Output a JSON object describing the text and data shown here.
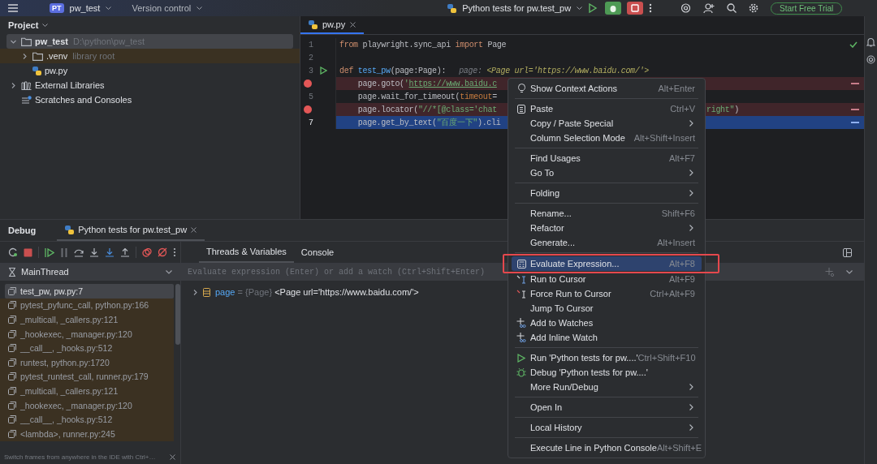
{
  "top_bar": {
    "project_badge": "PT",
    "project": "pw_test",
    "vcs": "Version control",
    "run_config": "Python tests for pw.test_pw",
    "trial_button": "Start Free Trial"
  },
  "project_panel": {
    "title": "Project",
    "tree": [
      {
        "label": "pw_test",
        "hint": "D:\\python\\pw_test",
        "kind": "folder",
        "expanded": true,
        "selected": true,
        "library": false,
        "children": [
          {
            "label": ".venv",
            "hint": "library root",
            "kind": "folder",
            "expanded": false,
            "selected": false,
            "library": true
          },
          {
            "label": "pw.py",
            "kind": "python",
            "selected": false,
            "library": false
          }
        ]
      },
      {
        "label": "External Libraries",
        "kind": "libraries",
        "expanded": false,
        "selected": false,
        "library": false
      },
      {
        "label": "Scratches and Consoles",
        "kind": "scratches",
        "selected": false,
        "library": false
      }
    ]
  },
  "editor": {
    "tabs": [
      {
        "label": "pw.py",
        "selected": true
      }
    ],
    "lines": [
      {
        "number": "1",
        "breakpoint": false,
        "current": false,
        "run": false,
        "tokens": [
          {
            "kind": "kw",
            "t": "from "
          },
          {
            "kind": "plain",
            "t": "playwright.sync_api "
          },
          {
            "kind": "kw",
            "t": "import "
          },
          {
            "kind": "plain",
            "t": "Page"
          }
        ]
      },
      {
        "number": "2",
        "breakpoint": false,
        "current": false,
        "run": false
      },
      {
        "number": "3",
        "breakpoint": false,
        "current": false,
        "run": true,
        "tokens": [
          {
            "kind": "kw",
            "t": "def "
          },
          {
            "kind": "fn",
            "t": "test_pw"
          },
          {
            "kind": "plain",
            "t": "(page:Page):"
          },
          {
            "kind": "hint",
            "t": "page: "
          },
          {
            "kind": "hintval",
            "t": "<Page url='https://www.baidu.com/'>"
          }
        ]
      },
      {
        "breakpoint": true,
        "current": false,
        "run": false,
        "tokens": [
          {
            "kind": "plain",
            "t": "    page.goto("
          },
          {
            "kind": "str",
            "t": "'"
          },
          {
            "kind": "link",
            "t": "https://www.baidu.c"
          }
        ]
      },
      {
        "number": "5",
        "breakpoint": false,
        "current": false,
        "run": false,
        "tokens": [
          {
            "kind": "plain",
            "t": "    page.wait_for_timeout("
          },
          {
            "kind": "param",
            "t": "timeout"
          },
          {
            "kind": "plain",
            "t": "="
          }
        ]
      },
      {
        "breakpoint": true,
        "current": false,
        "run": false,
        "tokens": [
          {
            "kind": "plain",
            "t": "    page.locator("
          },
          {
            "kind": "str",
            "t": "\"//*[@class='chat"
          }
        ],
        "tail": [
          {
            "kind": "str",
            "t": "right\""
          },
          {
            "kind": "plain",
            "t": ")"
          }
        ]
      },
      {
        "number": "7",
        "breakpoint": false,
        "current": true,
        "run": false,
        "tokens": [
          {
            "kind": "plain",
            "t": "    page.get_by_text("
          },
          {
            "kind": "str",
            "t": "\"百度一下\""
          },
          {
            "kind": "plain",
            "t": ").cli"
          }
        ]
      }
    ]
  },
  "context_menu": {
    "groups": [
      [
        {
          "kind": "bulb",
          "label": "Show Context Actions",
          "shortcut": "Alt+Enter",
          "submenu": false,
          "selected": false
        }
      ],
      [
        {
          "kind": "clipboard",
          "label": "Paste",
          "shortcut": "Ctrl+V",
          "submenu": false,
          "selected": false
        },
        {
          "kind": "plain",
          "label": "Copy / Paste Special",
          "submenu": true,
          "selected": false
        },
        {
          "kind": "plain",
          "label": "Column Selection Mode",
          "shortcut": "Alt+Shift+Insert",
          "submenu": false,
          "selected": false
        }
      ],
      [
        {
          "kind": "plain",
          "label": "Find Usages",
          "shortcut": "Alt+F7",
          "submenu": false,
          "selected": false
        },
        {
          "kind": "plain",
          "label": "Go To",
          "submenu": true,
          "selected": false
        }
      ],
      [
        {
          "kind": "plain",
          "label": "Folding",
          "submenu": true,
          "selected": false
        }
      ],
      [
        {
          "kind": "plain",
          "label": "Rename...",
          "shortcut": "Shift+F6",
          "submenu": false,
          "selected": false
        },
        {
          "kind": "plain",
          "label": "Refactor",
          "submenu": true,
          "selected": false
        },
        {
          "kind": "plain",
          "label": "Generate...",
          "shortcut": "Alt+Insert",
          "submenu": false,
          "selected": false
        }
      ],
      [
        {
          "kind": "calculator",
          "label": "Evaluate Expression...",
          "shortcut": "Alt+F8",
          "submenu": false,
          "selected": true,
          "outlined": true
        },
        {
          "kind": "cursor",
          "label": "Run to Cursor",
          "shortcut": "Alt+F9",
          "submenu": false,
          "selected": false
        },
        {
          "kind": "force",
          "label": "Force Run to Cursor",
          "shortcut": "Ctrl+Alt+F9",
          "submenu": false,
          "selected": false
        },
        {
          "kind": "plain",
          "label": "Jump To Cursor",
          "submenu": false,
          "selected": false
        },
        {
          "kind": "watch",
          "label": "Add to Watches",
          "submenu": false,
          "selected": false
        },
        {
          "kind": "watch",
          "label": "Add Inline Watch",
          "submenu": false,
          "selected": false
        }
      ],
      [
        {
          "kind": "run",
          "label": "Run 'Python tests for pw....'",
          "shortcut": "Ctrl+Shift+F10",
          "submenu": false,
          "selected": false
        },
        {
          "kind": "debug",
          "label": "Debug 'Python tests for pw....'",
          "submenu": false,
          "selected": false
        },
        {
          "kind": "plain",
          "label": "More Run/Debug",
          "submenu": true,
          "selected": false
        }
      ],
      [
        {
          "kind": "plain",
          "label": "Open In",
          "submenu": true,
          "selected": false
        }
      ],
      [
        {
          "kind": "plain",
          "label": "Local History",
          "submenu": true,
          "selected": false
        }
      ],
      [
        {
          "kind": "plain",
          "label": "Execute Line in Python Console",
          "shortcut": "Alt+Shift+E",
          "submenu": false,
          "selected": false
        }
      ]
    ]
  },
  "debug": {
    "title": "Debug",
    "session_tab": {
      "label": "Python tests for pw.test_pw",
      "selected": true
    },
    "view_tabs": [
      {
        "label": "Threads & Variables",
        "selected": true
      },
      {
        "label": "Console",
        "selected": false
      }
    ],
    "thread": "MainThread",
    "evaluate": {
      "placeholder": "Evaluate expression (Enter) or add a watch (Ctrl+Shift+Enter)"
    },
    "frames": [
      {
        "label": "test_pw, pw.py:7",
        "selected": true,
        "library": false
      },
      {
        "label": "pytest_pyfunc_call, python.py:166",
        "selected": false,
        "library": true
      },
      {
        "label": "_multicall, _callers.py:121",
        "selected": false,
        "library": true
      },
      {
        "label": "_hookexec, _manager.py:120",
        "selected": false,
        "library": true
      },
      {
        "label": "__call__, _hooks.py:512",
        "selected": false,
        "library": true
      },
      {
        "label": "runtest, python.py:1720",
        "selected": false,
        "library": true
      },
      {
        "label": "pytest_runtest_call, runner.py:179",
        "selected": false,
        "library": true
      },
      {
        "label": "_multicall, _callers.py:121",
        "selected": false,
        "library": true
      },
      {
        "label": "_hookexec, _manager.py:120",
        "selected": false,
        "library": true
      },
      {
        "label": "__call__, _hooks.py:512",
        "selected": false,
        "library": true
      },
      {
        "label": "<lambda>, runner.py:245",
        "selected": false,
        "library": true
      }
    ],
    "hint": "Switch frames from anywhere in the IDE with Ctrl+…",
    "variables": [
      {
        "name": "page",
        "separator": "=",
        "type": "{Page}",
        "value": "<Page url='https://www.baidu.com/'>",
        "expanded": false
      }
    ]
  }
}
